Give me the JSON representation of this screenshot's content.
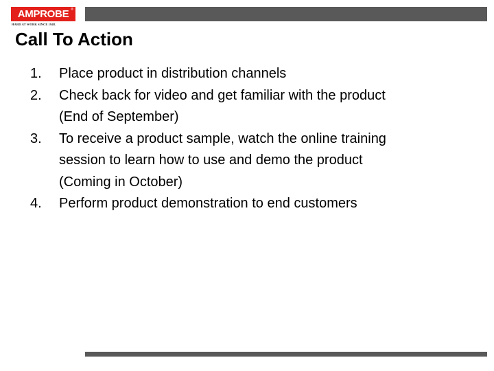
{
  "logo": {
    "brand": "AMPROBE",
    "registered_mark": "®",
    "tagline": "HARD AT WORK SINCE 1948.",
    "color": "#e3201b"
  },
  "decor": {
    "bar_color": "#595959"
  },
  "slide": {
    "title": "Call To Action",
    "items": [
      {
        "number": "1.",
        "lines": [
          "Place product in distribution channels"
        ]
      },
      {
        "number": "2.",
        "lines": [
          "Check back for video and get familiar with the product",
          "(End of September)"
        ]
      },
      {
        "number": "3.",
        "lines": [
          "To receive a product sample, watch the online training",
          "session to learn how to use and demo the product",
          "(Coming in October)"
        ]
      },
      {
        "number": "4.",
        "lines": [
          "Perform product demonstration to end customers"
        ]
      }
    ]
  }
}
